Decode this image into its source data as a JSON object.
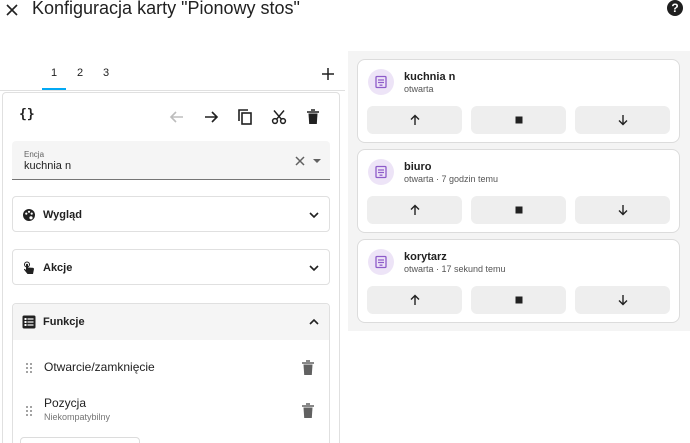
{
  "header": {
    "title": "Konfiguracja karty \"Pionowy stos\"",
    "help_label": "?"
  },
  "tabs": [
    {
      "label": "1",
      "active": true
    },
    {
      "label": "2",
      "active": false
    },
    {
      "label": "3",
      "active": false
    }
  ],
  "editor": {
    "code_label": "{}",
    "entity": {
      "label": "Encja",
      "value": "kuchnia n"
    },
    "sections": [
      {
        "label": "Wygląd",
        "icon": "palette-icon",
        "expanded": false
      },
      {
        "label": "Akcje",
        "icon": "gesture-tap-icon",
        "expanded": false
      },
      {
        "label": "Funkcje",
        "icon": "list-box-icon",
        "expanded": true
      }
    ],
    "features": [
      {
        "name": "Otwarcie/zamknięcie",
        "subtitle": ""
      },
      {
        "name": "Pozycja",
        "subtitle": "Niekompatybilny"
      }
    ]
  },
  "preview": {
    "tiles": [
      {
        "name": "kuchnia n",
        "state": "otwarta",
        "icon": "window-shutter-icon"
      },
      {
        "name": "biuro",
        "state": "otwarta · 7 godzin temu",
        "icon": "window-shutter-icon"
      },
      {
        "name": "korytarz",
        "state": "otwarta · 17 sekund temu",
        "icon": "window-shutter-icon"
      }
    ]
  },
  "colors": {
    "accent": "#03a9f4",
    "tile_icon_bg": "#ede4f7",
    "tile_icon_fg": "#8e5bc9",
    "control_bg": "#eeeeee",
    "preview_bg": "#f4f4f4"
  }
}
